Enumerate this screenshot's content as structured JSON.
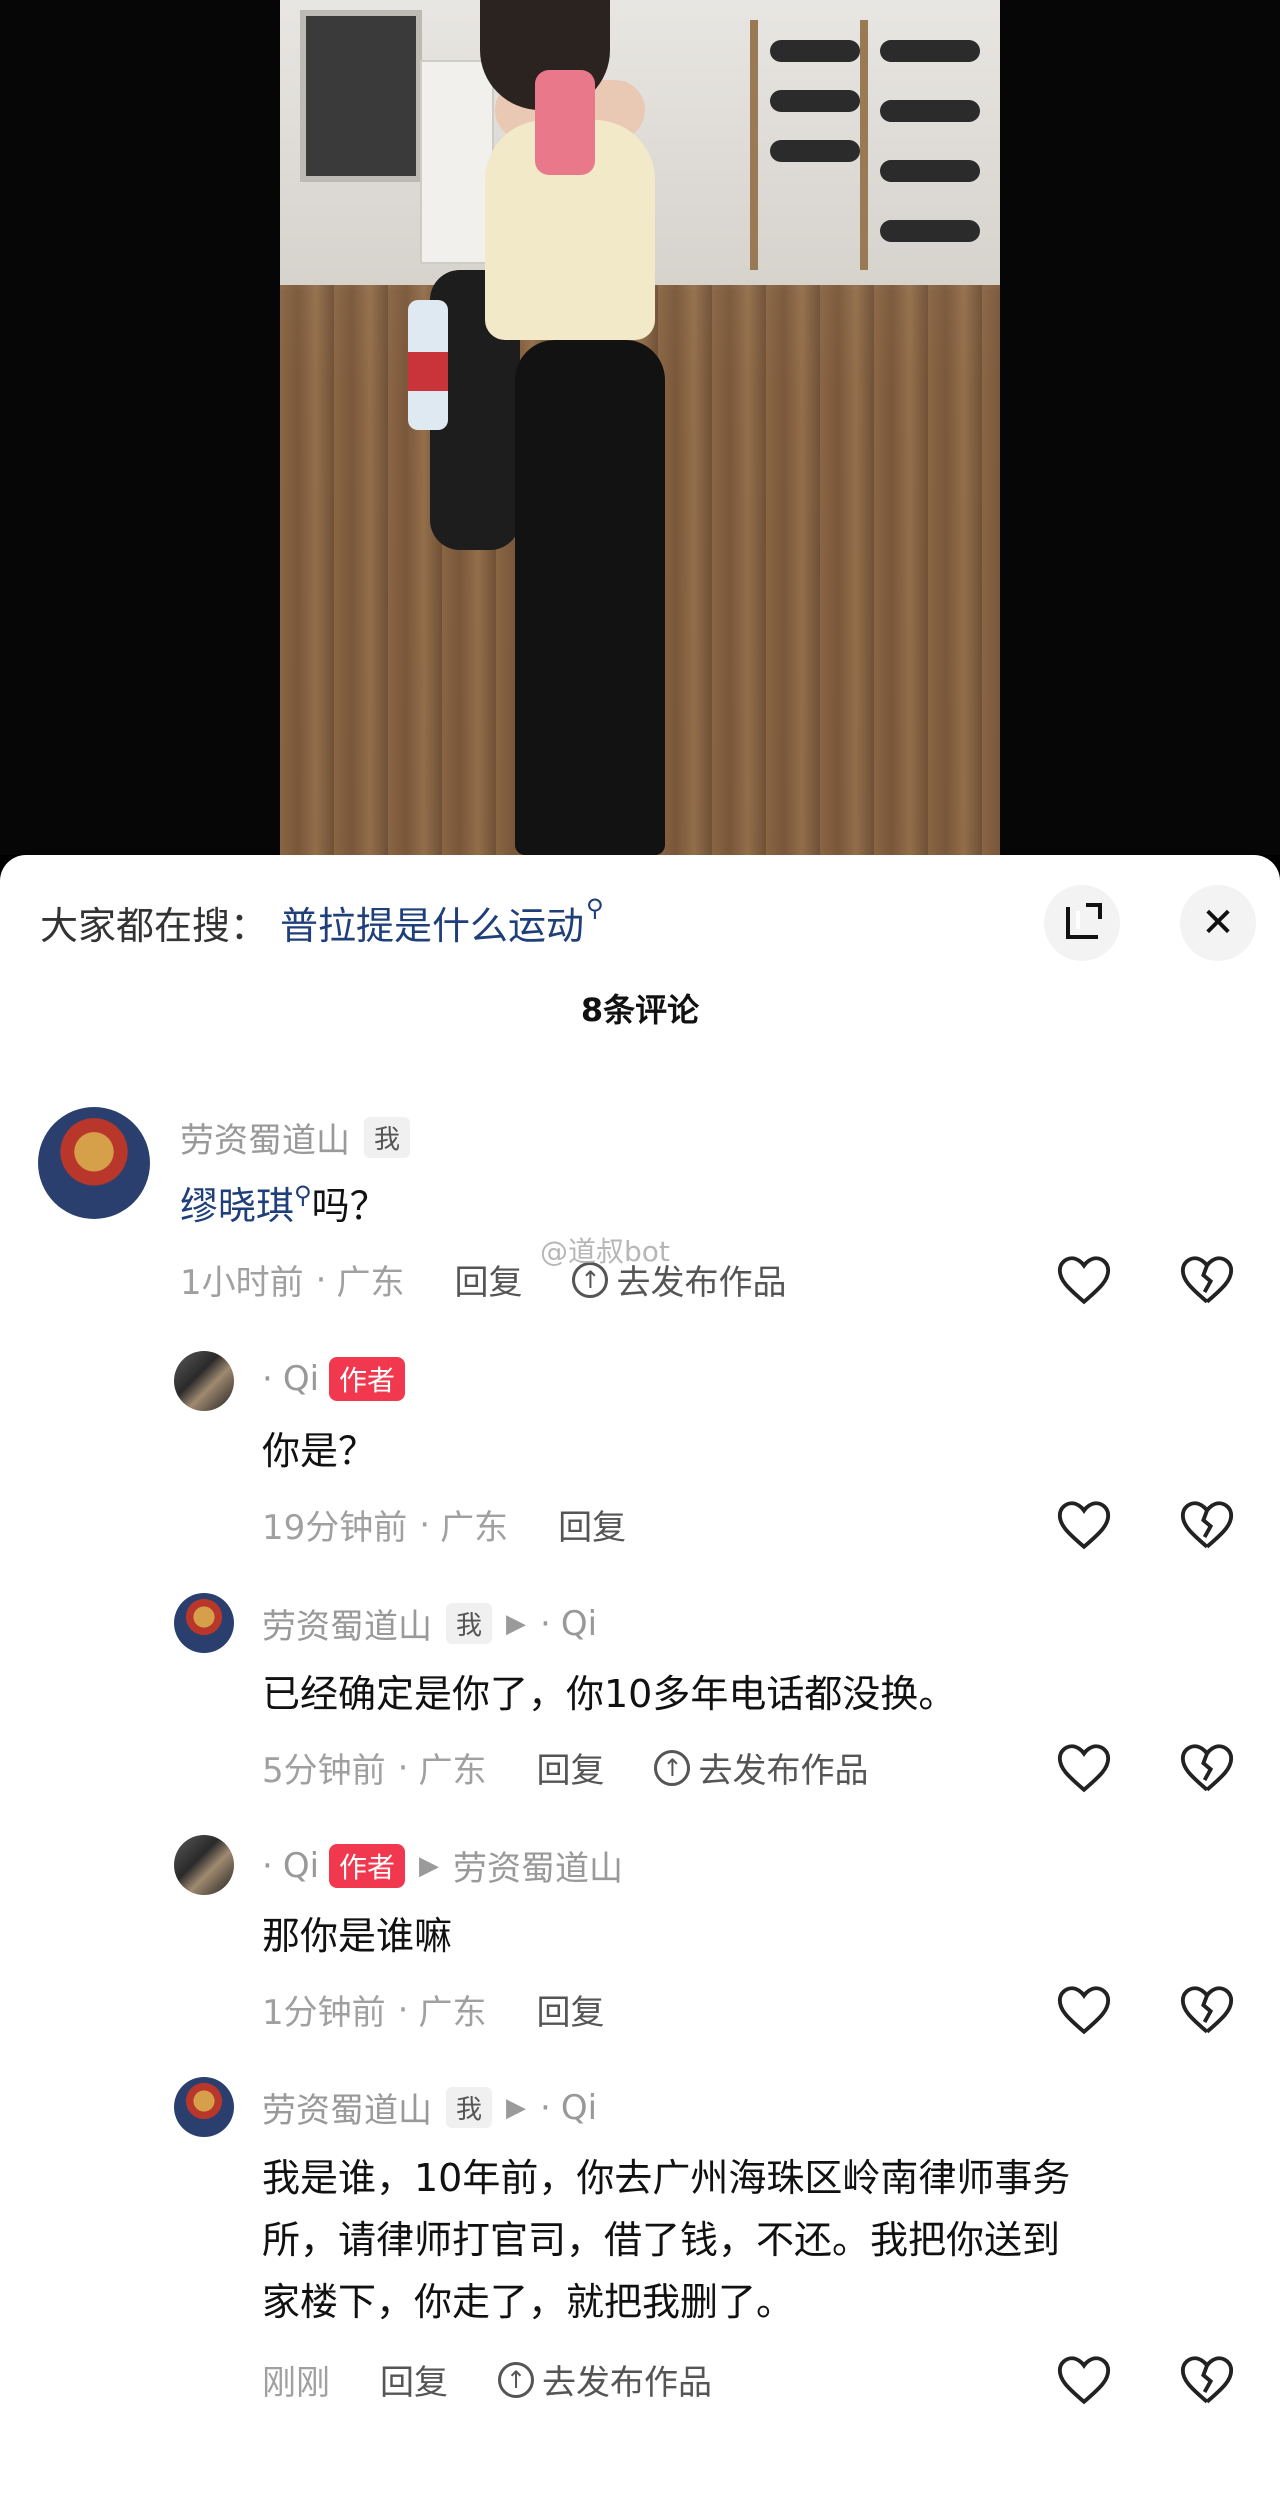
{
  "search": {
    "prefix": "大家都在搜：",
    "term": "普拉提是什么运动",
    "term_icon": "search-icon"
  },
  "comments_title": "8条评论",
  "watermark": "@道叔bot",
  "comments": [
    {
      "name": "劳资蜀道山",
      "badge": "我",
      "text_link": "缪晓琪",
      "text_after": "吗？",
      "time": "1小时前",
      "location": "广东",
      "reply": "回复",
      "publish": "去发布作品"
    },
    {
      "name": "Qi",
      "badge_author": "作者",
      "text": "你是？",
      "time": "19分钟前",
      "location": "广东",
      "reply": "回复"
    },
    {
      "name": "劳资蜀道山",
      "badge": "我",
      "reply_to": "Qi",
      "text": "已经确定是你了，你10多年电话都没换。",
      "time": "5分钟前",
      "location": "广东",
      "reply": "回复",
      "publish": "去发布作品"
    },
    {
      "name": "Qi",
      "badge_author": "作者",
      "reply_to": "劳资蜀道山",
      "text": "那你是谁嘛",
      "time": "1分钟前",
      "location": "广东",
      "reply": "回复"
    },
    {
      "name": "劳资蜀道山",
      "badge": "我",
      "reply_to": "Qi",
      "text_line1": "我是谁，10年前，你去广州海珠区岭南律师事务",
      "text_line2": "所，请律师打官司，借了钱，不还。我把你送到",
      "text_line3": "家楼下，你走了，就把我删了。",
      "time": "刚刚",
      "reply": "回复",
      "publish": "去发布作品"
    }
  ],
  "icons": {
    "like": "heart-icon",
    "dislike": "broken-heart-icon",
    "expand": "expand-icon",
    "close": "close-icon",
    "publish": "upload-icon"
  }
}
